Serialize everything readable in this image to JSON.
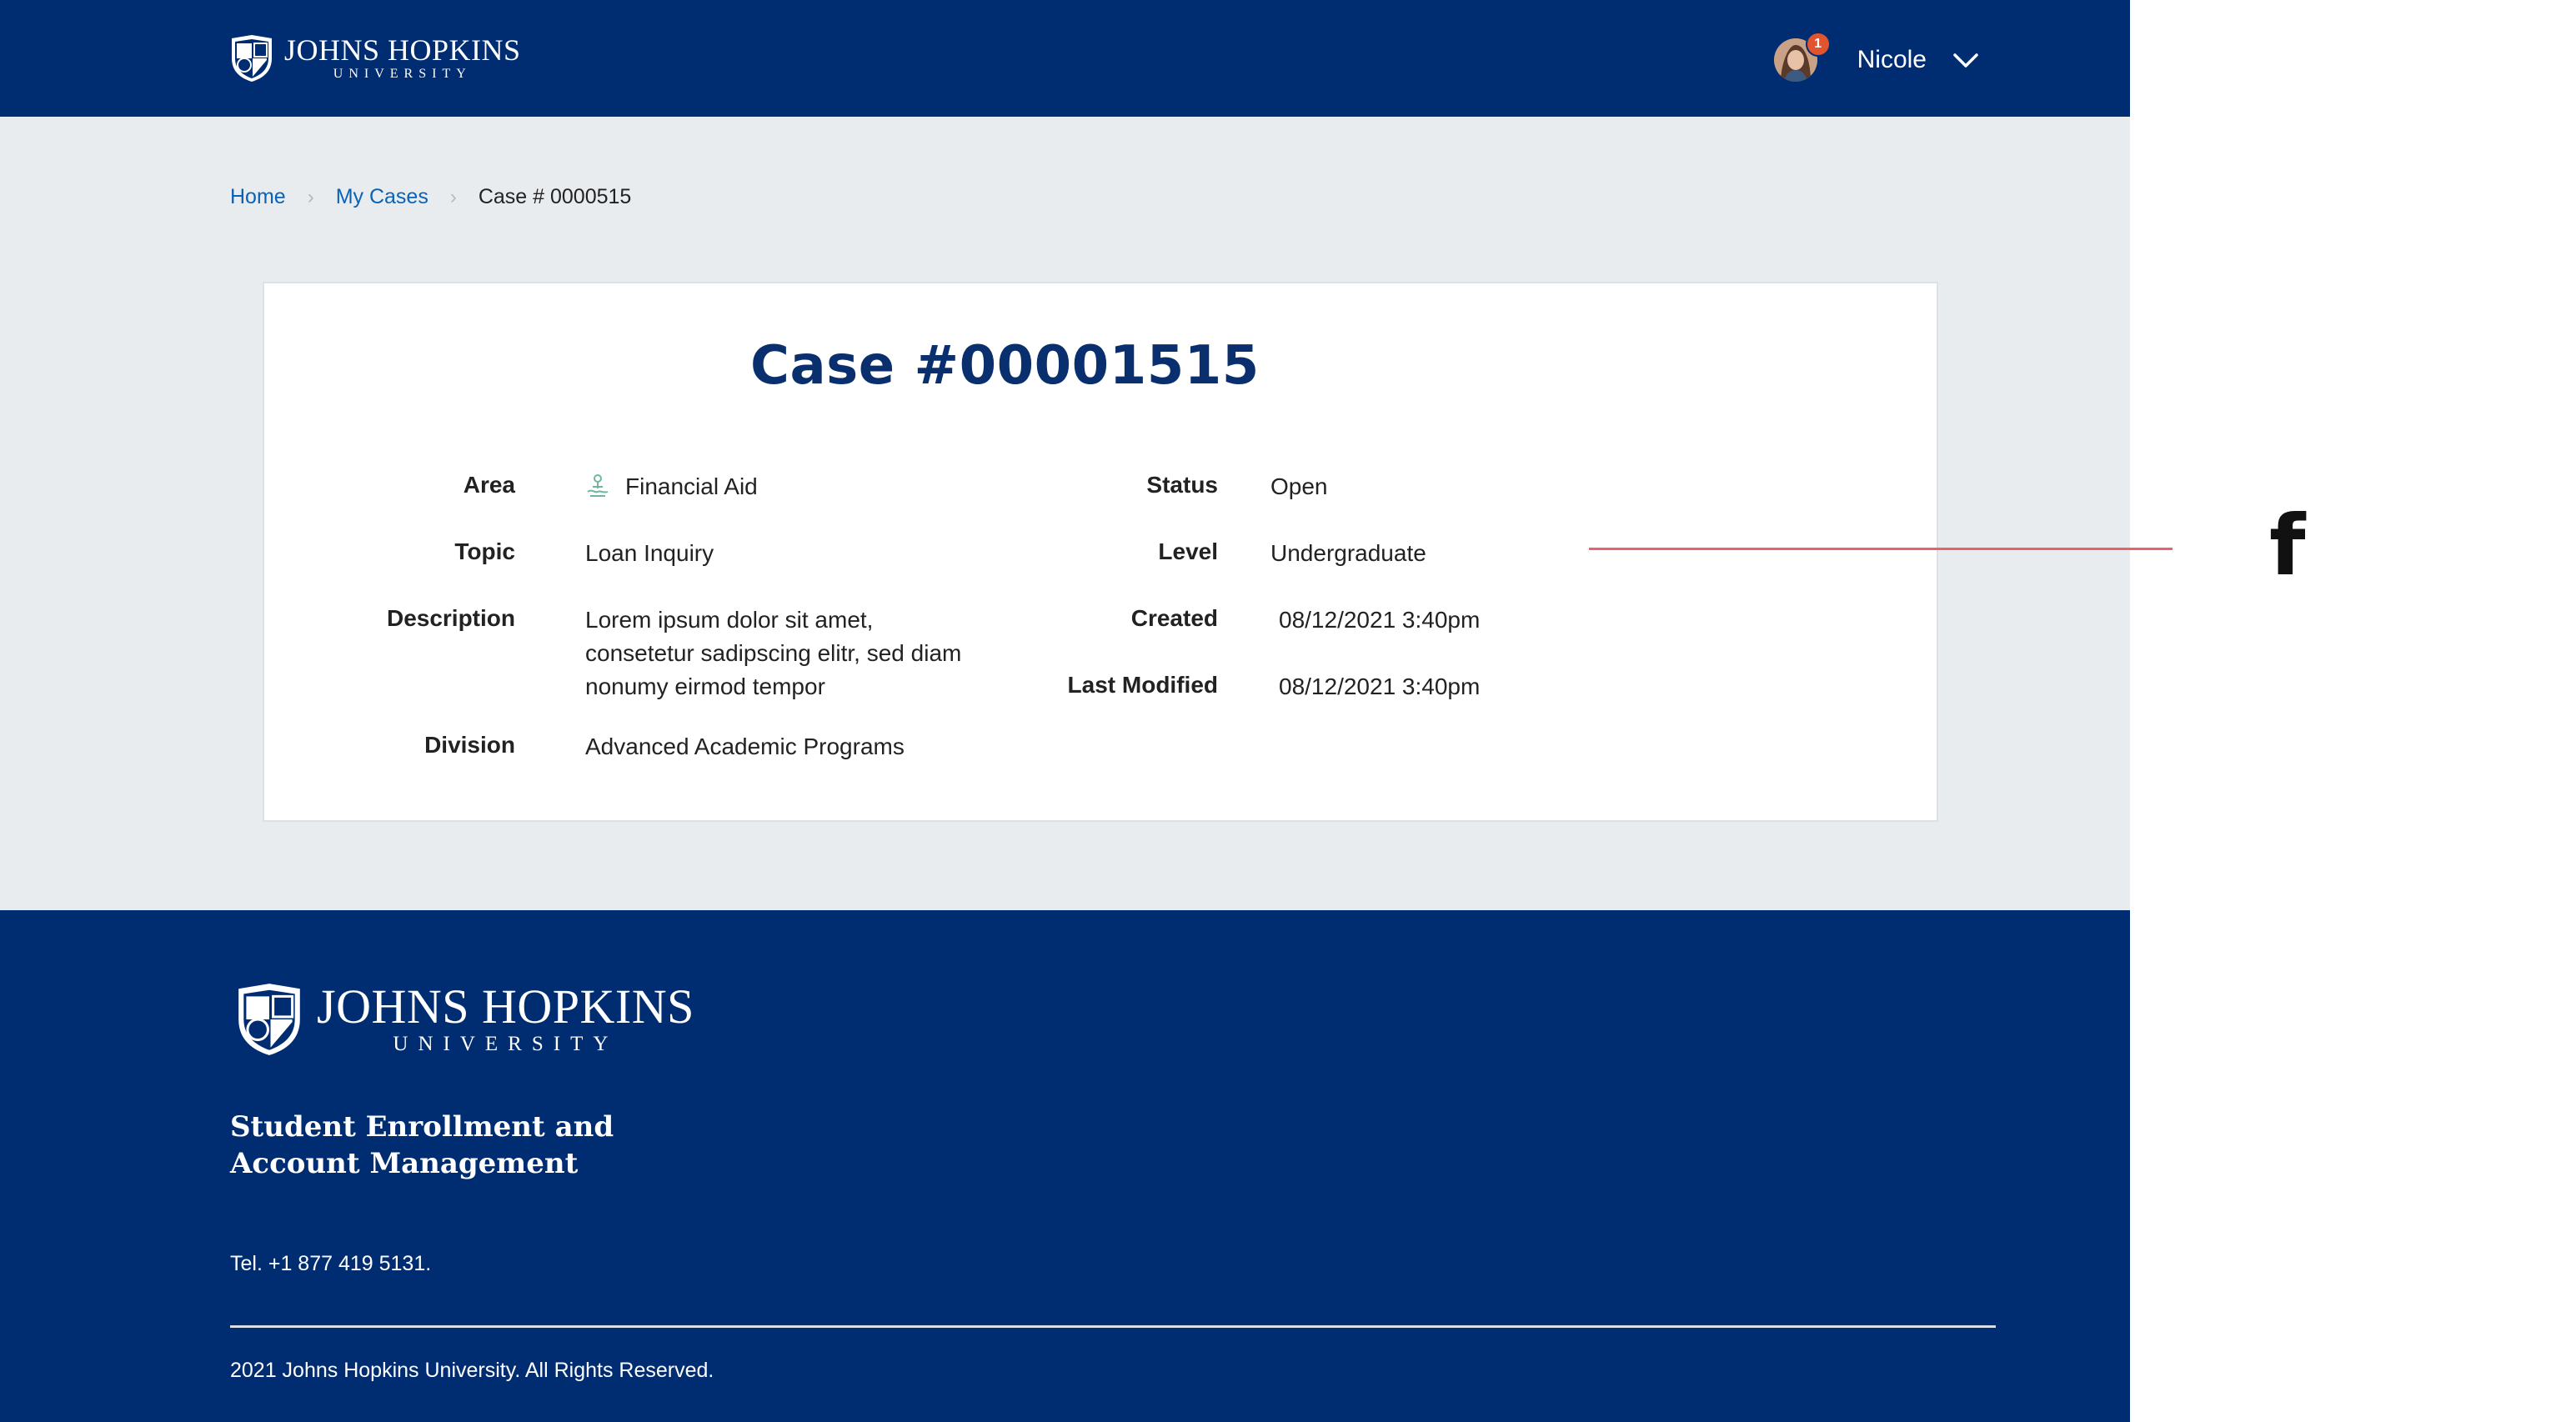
{
  "brand": {
    "name": "JOHNS HOPKINS",
    "sub": "UNIVERSITY",
    "colors": {
      "navy": "#002d72",
      "link": "#0a62b5",
      "title": "#0a2f6e",
      "badge": "#e0542e",
      "annotation": "#e8616b"
    }
  },
  "header": {
    "user_name": "Nicole",
    "notification_count": "1",
    "chevron_icon": "chevron-down-icon"
  },
  "breadcrumb": {
    "home": "Home",
    "my_cases": "My Cases",
    "current": "Case # 0000515"
  },
  "case": {
    "title": "Case #00001515",
    "area_icon": "financial-aid-icon",
    "fields": {
      "area": {
        "label": "Area",
        "value": "Financial Aid"
      },
      "topic": {
        "label": "Topic",
        "value": "Loan Inquiry"
      },
      "description": {
        "label": "Description",
        "value": "Lorem ipsum dolor sit amet, consetetur sadipscing elitr, sed diam nonumy eirmod tempor"
      },
      "division": {
        "label": "Division",
        "value": "Advanced Academic Programs"
      },
      "status": {
        "label": "Status",
        "value": "Open"
      },
      "level": {
        "label": "Level",
        "value": "Undergraduate"
      },
      "created": {
        "label": "Created",
        "value": "08/12/2021 3:40pm"
      },
      "last_modified": {
        "label": "Last Modified",
        "value": "08/12/2021 3:40pm"
      }
    }
  },
  "footer": {
    "org": "Student Enrollment and Account Management",
    "tel": "Tel. +1 877 419 5131.",
    "copyright": "2021 Johns Hopkins University. All Rights Reserved."
  },
  "annotation": {
    "letter": "f"
  }
}
